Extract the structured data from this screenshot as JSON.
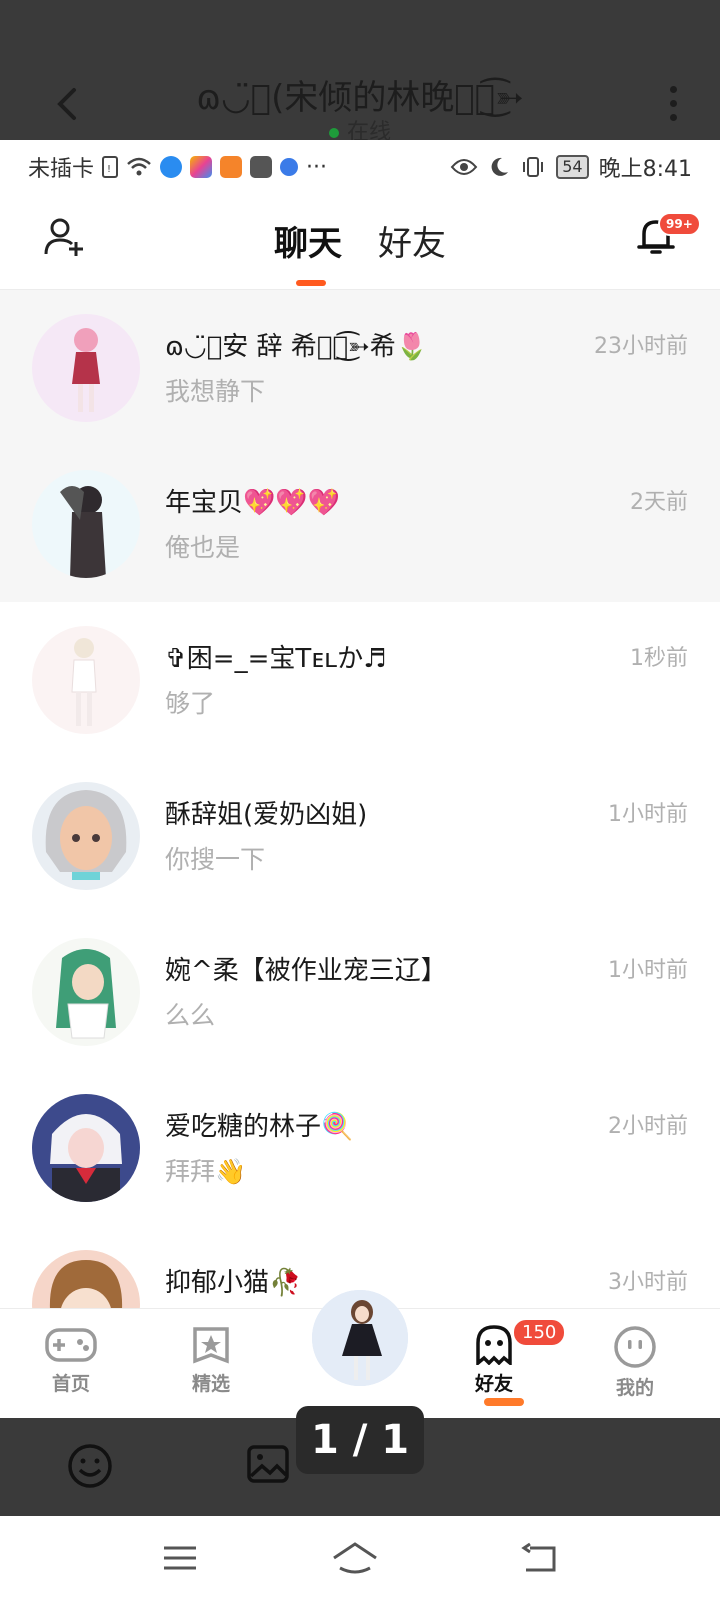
{
  "outer": {
    "title": "ɷ◡̈⃝(宋倾的林晚ঔৣ͜͡➳",
    "status": "在线"
  },
  "statusbar": {
    "carrier": "未插卡",
    "more": "···",
    "battery": "54",
    "time": "晚上8:41"
  },
  "appbar": {
    "tabs": [
      "聊天",
      "好友"
    ],
    "notification_badge": "99+"
  },
  "chats": [
    {
      "name": "ɷ◡̈⃝安 辞 希ঔৣ͜͡➳希🌷",
      "time": "23小时前",
      "message": "我想静下"
    },
    {
      "name": "年宝贝💖💖💖",
      "time": "2天前",
      "message": "俺也是"
    },
    {
      "name": "✞困=_=宝Tᴇʟか♬",
      "time": "1秒前",
      "message": "够了"
    },
    {
      "name": "酥辞姐(爱奶凶姐)",
      "time": "1小时前",
      "message": "你搜一下"
    },
    {
      "name": "婉^柔【被作业宠三辽】",
      "time": "1小时前",
      "message": "么么"
    },
    {
      "name": "爱吃糖的林子🍭",
      "time": "2小时前",
      "message": "拜拜👋"
    },
    {
      "name": "抑郁小猫🥀",
      "time": "3小时前",
      "message": ""
    }
  ],
  "bottomnav": {
    "items": [
      "首页",
      "精选",
      "好友",
      "我的"
    ],
    "friends_badge": "150"
  },
  "page_indicator": "1 / 1",
  "colors": {
    "accent": "#ff5a1f",
    "badge": "#f04b3b",
    "outer_overlay": "#3a3a3a"
  }
}
